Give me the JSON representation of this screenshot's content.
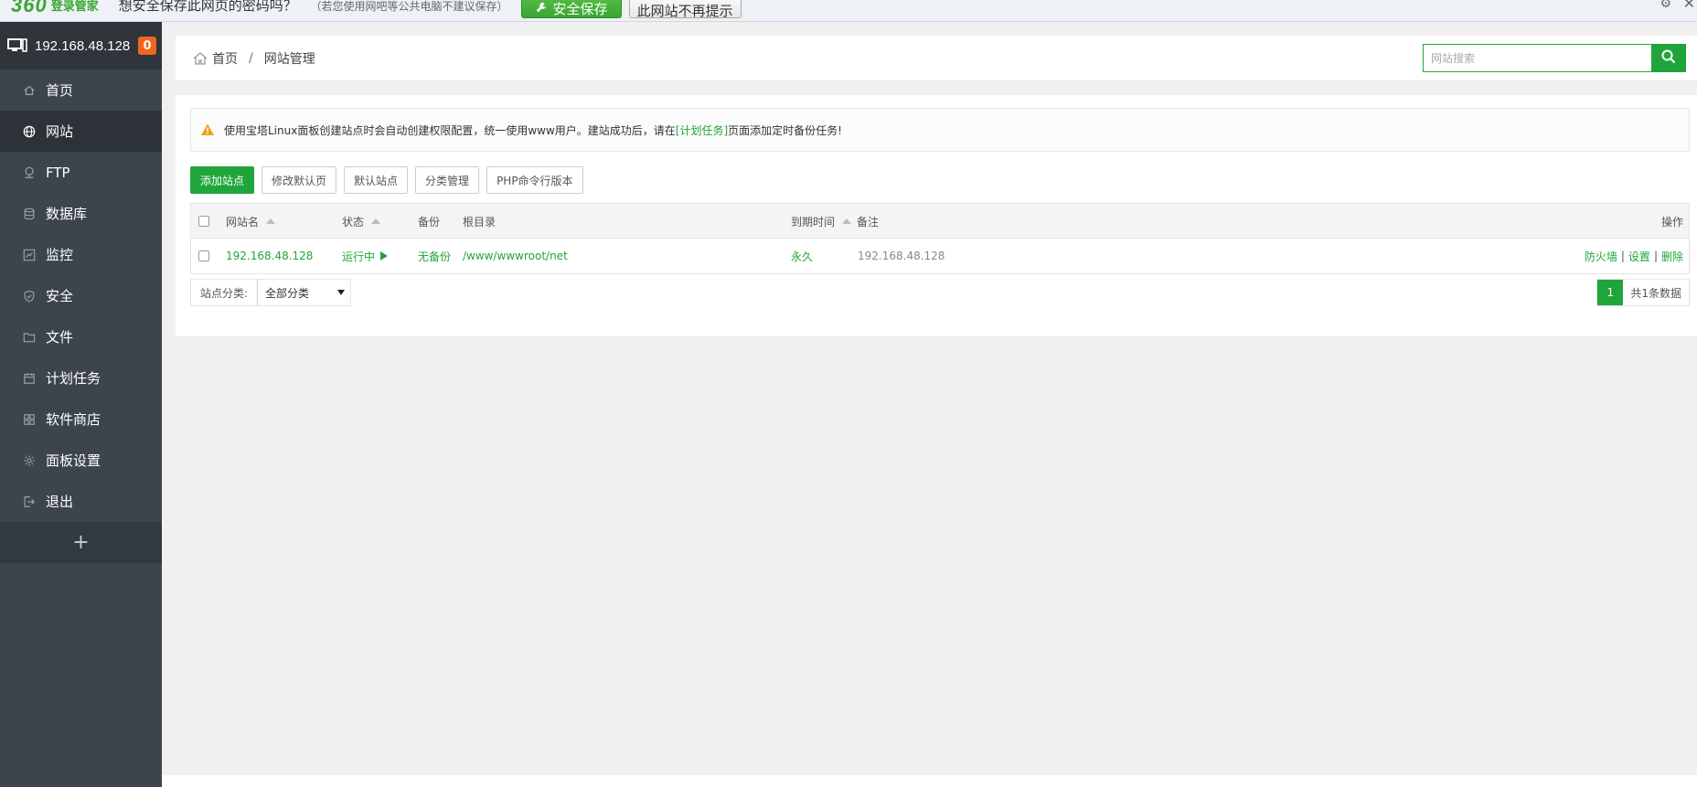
{
  "pwbar": {
    "logo_num": "360",
    "logo_brand": "登录管家",
    "question": "想安全保存此网页的密码吗？",
    "note": "（若您使用网吧等公共电脑不建议保存）",
    "save_label": "安全保存",
    "never_label": "此网站不再提示"
  },
  "sidebar": {
    "host": "192.168.48.128",
    "badge": "0",
    "items": [
      {
        "label": "首页",
        "icon": "home-icon"
      },
      {
        "label": "网站",
        "icon": "globe-icon"
      },
      {
        "label": "FTP",
        "icon": "ftp-icon"
      },
      {
        "label": "数据库",
        "icon": "database-icon"
      },
      {
        "label": "监控",
        "icon": "monitor-chart-icon"
      },
      {
        "label": "安全",
        "icon": "shield-icon"
      },
      {
        "label": "文件",
        "icon": "folder-icon"
      },
      {
        "label": "计划任务",
        "icon": "calendar-icon"
      },
      {
        "label": "软件商店",
        "icon": "apps-grid-icon"
      },
      {
        "label": "面板设置",
        "icon": "gear-icon"
      },
      {
        "label": "退出",
        "icon": "logout-icon"
      }
    ],
    "plus": "+"
  },
  "breadcrumb": {
    "home": "首页",
    "sep": "/",
    "current": "网站管理"
  },
  "search": {
    "placeholder": "网站搜索"
  },
  "notice": {
    "pre": "使用宝塔Linux面板创建站点时会自动创建权限配置，统一使用www用户。建站成功后，请在",
    "link": "[计划任务]",
    "post": "页面添加定时备份任务!"
  },
  "toolbar": {
    "add_site": "添加站点",
    "default_page": "修改默认页",
    "default_site": "默认站点",
    "categories": "分类管理",
    "php_cli": "PHP命令行版本"
  },
  "table": {
    "headers": {
      "name": "网站名",
      "status": "状态",
      "backup": "备份",
      "root": "根目录",
      "expire": "到期时间",
      "remark": "备注",
      "actions": "操作"
    },
    "rows": [
      {
        "name": "192.168.48.128",
        "status": "运行中",
        "backup": "无备份",
        "root": "/www/wwwroot/net",
        "expire": "永久",
        "remark": "192.168.48.128",
        "op_firewall": "防火墙",
        "op_settings": "设置",
        "op_delete": "删除"
      }
    ]
  },
  "footer": {
    "category_label": "站点分类:",
    "category_value": "全部分类",
    "page_current": "1",
    "page_total": "共1条数据"
  },
  "colors": {
    "accent": "#20a53a",
    "sidebar_bg": "#3c444d",
    "badge": "#f0661a"
  }
}
